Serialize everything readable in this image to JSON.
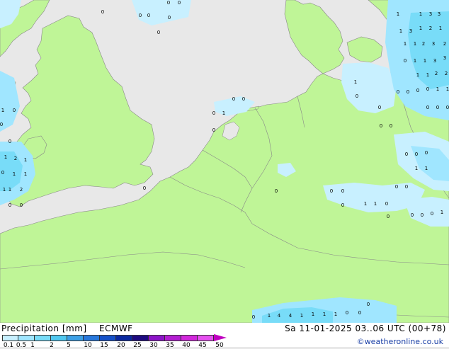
{
  "legend": {
    "title": "Precipitation [mm]",
    "model": "ECMWF",
    "datetime": "Sa 11-01-2025 03..06 UTC (00+78)",
    "credit": "©weatheronline.co.uk",
    "scale_labels": [
      "0.1",
      "0.5",
      "1",
      "2",
      "5",
      "10",
      "15",
      "20",
      "25",
      "30",
      "35",
      "40",
      "45",
      "50"
    ],
    "scale_colors": [
      "#c8f0ff",
      "#a0e6ff",
      "#78dcf8",
      "#50c8f0",
      "#3ca0e6",
      "#2878dc",
      "#1450c8",
      "#0a28a0",
      "#1e0a80",
      "#8c14c8",
      "#b41ed2",
      "#d228dc",
      "#e650f0"
    ]
  },
  "colors": {
    "land": "#bff597",
    "sea": "#e8e8e8",
    "light_precip": "#c8f0ff",
    "moderate_precip": "#a0e6ff",
    "heavier_precip": "#78dcf8"
  },
  "map": {
    "region": "North Sea, British Isles, Benelux, Germany, Denmark, France",
    "value_labels": [
      "0",
      "0",
      "0",
      "0",
      "0",
      "0",
      "0",
      "1",
      "0",
      "0",
      "0",
      "1",
      "2",
      "1",
      "0",
      "0",
      "0",
      "1",
      "1",
      "0",
      "0",
      "1",
      "1",
      "2",
      "3",
      "3",
      "1",
      "1",
      "3",
      "2",
      "1",
      "1",
      "1",
      "0",
      "0",
      "0",
      "1",
      "0",
      "1",
      "0",
      "2",
      "0",
      "0",
      "0",
      "2",
      "1",
      "1",
      "1",
      "2",
      "0",
      "0",
      "0",
      "0",
      "1",
      "1",
      "0",
      "0",
      "0",
      "0",
      "0",
      "0",
      "0",
      "0",
      "1",
      "1",
      "1",
      "0",
      "1",
      "0",
      "0",
      "0",
      "0",
      "0",
      "0",
      "1",
      "1",
      "4",
      "1",
      "1",
      "1",
      "0",
      "0",
      "0"
    ]
  }
}
